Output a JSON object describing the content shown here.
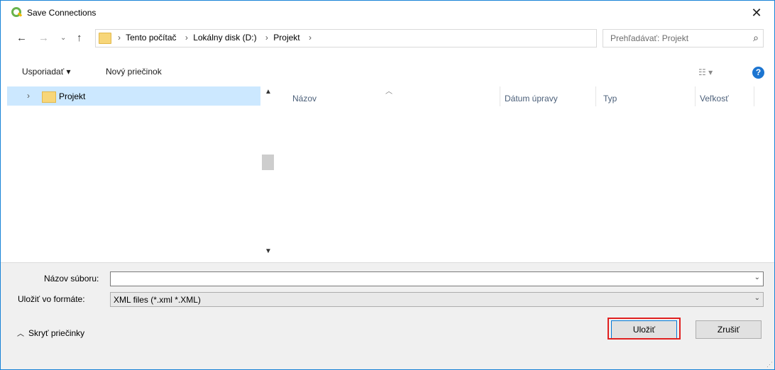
{
  "window": {
    "title": "Save Connections",
    "close_glyph": "✕"
  },
  "address": {
    "crumbs": [
      "Tento počítač",
      "Lokálny disk (D:)",
      "Projekt"
    ],
    "search_placeholder": "Prehľadávať: Projekt"
  },
  "toolbar": {
    "organize_label": "Usporiadať ▾",
    "new_folder_label": "Nový priečinok",
    "view_glyph": "☷ ▾",
    "help_glyph": "?"
  },
  "tree": {
    "items": [
      {
        "label": "Projekt",
        "selected": true
      }
    ]
  },
  "columns": {
    "name": "Názov",
    "date": "Dátum úpravy",
    "type": "Typ",
    "size": "Veľkosť"
  },
  "form": {
    "filename_label": "Názov súboru:",
    "filename_value": "",
    "filetype_label": "Uložiť vo formáte:",
    "filetype_value": "XML files (*.xml *.XML)"
  },
  "footer": {
    "hide_folders_label": "Skryť priečinky",
    "save_label": "Uložiť",
    "cancel_label": "Zrušiť"
  },
  "colors": {
    "accent": "#0078d7",
    "selection": "#cce8ff",
    "highlight_frame": "#e02020"
  }
}
